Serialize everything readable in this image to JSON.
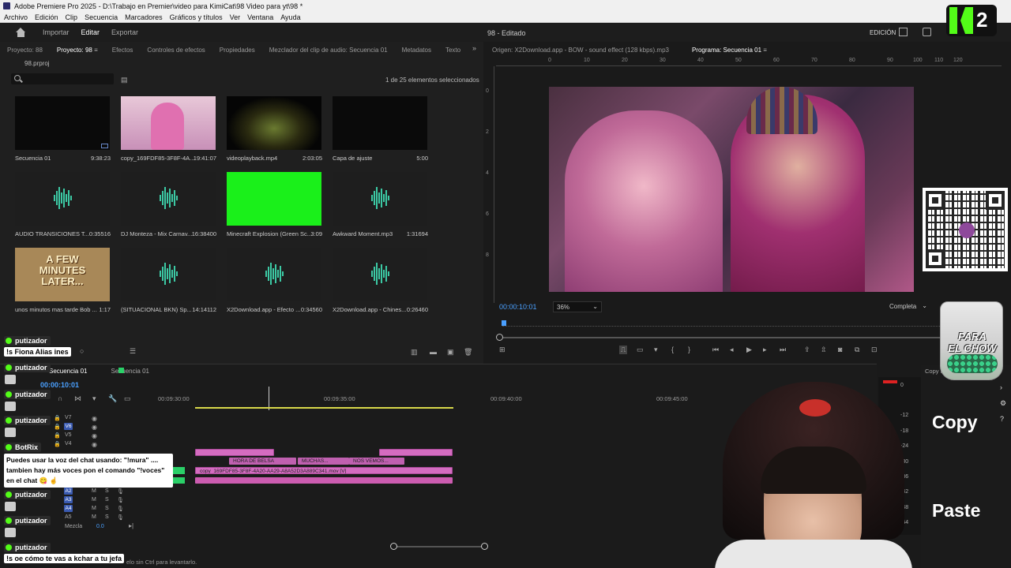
{
  "window": {
    "title": "Adobe Premiere Pro 2025 - D:\\Trabajo en Premier\\video para KimiCat\\98 Video para yt\\98 *"
  },
  "menu": [
    "Archivo",
    "Edición",
    "Clip",
    "Secuencia",
    "Marcadores",
    "Gráficos y títulos",
    "Ver",
    "Ventana",
    "Ayuda"
  ],
  "workspace": {
    "tabs": [
      "Importar",
      "Editar",
      "Exportar"
    ],
    "active": "Editar",
    "doc_title": "98 - Editado",
    "mode": "EDICIÓN"
  },
  "project_panel": {
    "tabs": [
      "Proyecto: 88",
      "Proyecto: 98",
      "Efectos",
      "Controles de efectos",
      "Propiedades",
      "Mezclador del clip de audio: Secuencia 01",
      "Metadatos",
      "Texto"
    ],
    "active_tab": "Proyecto: 98",
    "file": "98.prproj",
    "selection_info": "1 de 25 elementos seleccionados",
    "items": [
      {
        "name": "Secuencia 01",
        "duration": "9:38:23",
        "kind": "video"
      },
      {
        "name": "copy_169FDF85-3F8F-4A...",
        "duration": "19:41:07",
        "kind": "video"
      },
      {
        "name": "videoplayback.mp4",
        "duration": "2:03:05",
        "kind": "video"
      },
      {
        "name": "Capa de ajuste",
        "duration": "5:00",
        "kind": "video"
      },
      {
        "name": "AUDIO TRANSICIONES T...",
        "duration": "0:35516",
        "kind": "audio"
      },
      {
        "name": "DJ Monteza - Mix Carnav...",
        "duration": "16:38400",
        "kind": "audio"
      },
      {
        "name": "Minecraft Explosion (Green Sc...",
        "duration": "3:09",
        "kind": "video"
      },
      {
        "name": "Awkward Moment.mp3",
        "duration": "1:31694",
        "kind": "audio"
      },
      {
        "name": "unos minutos mas tarde Bob ...",
        "duration": "1:17",
        "kind": "video"
      },
      {
        "name": "(SITUACIONAL BKN) Sp...",
        "duration": "14:14112",
        "kind": "audio"
      },
      {
        "name": "X2Download.app - Efecto ...",
        "duration": "0:34560",
        "kind": "audio"
      },
      {
        "name": "X2Download.app - Chines...",
        "duration": "0:26460",
        "kind": "audio"
      }
    ],
    "thumb_text": [
      "A FEW",
      "MINUTES",
      "LATER..."
    ]
  },
  "monitor": {
    "tabs": [
      "Origen: X2Download.app - BOW - sound effect (128 kbps).mp3",
      "Programa: Secuencia 01"
    ],
    "active_tab": "Programa: Secuencia 01",
    "timecode": "00:00:10:01",
    "zoom": "36%",
    "resolution": "Completa",
    "ruler_ticks": [
      "0",
      "10",
      "20",
      "30",
      "40",
      "50",
      "60",
      "70",
      "80",
      "90",
      "100",
      "110",
      "120"
    ],
    "vruler_ticks": [
      "0",
      "2",
      "4",
      "6",
      "8"
    ]
  },
  "timeline": {
    "tabs": [
      "Secuencia 01",
      "Secuencia 01"
    ],
    "timecode": "00:00:10:01",
    "ruler": [
      "00:09:30:00",
      "00:09:35:00",
      "00:09:40:00",
      "00:09:45:00",
      "00"
    ],
    "video_tracks": [
      "V7",
      "V6",
      "V5",
      "V4"
    ],
    "audio_tracks": [
      "A2",
      "A3",
      "A4",
      "A5"
    ],
    "mix_label": "Mezcla",
    "mix_value": "0.0",
    "clips": {
      "c1": "HORA DE BELSA",
      "c2": "MUCHAS...",
      "c3": "NOS VEMOS...",
      "main": "copy_169FDF85-3F8F-4A20-AA29-A8A52D3A889C341.mov [V]"
    },
    "status": "elo sin Ctrl para levantarlo."
  },
  "meter": {
    "ticks": [
      "0",
      "-12",
      "-18",
      "-24",
      "-30",
      "-36",
      "-42",
      "-48",
      "-54"
    ]
  },
  "side_panel": {
    "tab": "Copy P",
    "copy": "Copy",
    "paste": "Paste"
  },
  "overlay": {
    "jar_line1": "PARA",
    "jar_line2": "EL CHOW",
    "k2_digit": "2",
    "chat": [
      {
        "user": "putizador",
        "msg": "!s Fiona Alias ines"
      },
      {
        "user": "putizador",
        "msg": ""
      },
      {
        "user": "putizador",
        "msg": ""
      },
      {
        "user": "BotRix",
        "msg": "Puedes usar la voz del chat usando: \"!mura\" .... tambien hay más voces pon el comando \"!voces\" en el chat 😋 ☝️"
      },
      {
        "user": "putizador",
        "msg": ""
      },
      {
        "user": "putizador",
        "msg": ""
      },
      {
        "user": "putizador",
        "msg": "!s oe cómo te vas a kchar a tu jefa"
      }
    ]
  },
  "colors": {
    "accent_blue": "#4aa0ff",
    "clip_pink": "#d46cc0",
    "kick_green": "#53fc18",
    "audio_wave": "#3cc9a4"
  }
}
